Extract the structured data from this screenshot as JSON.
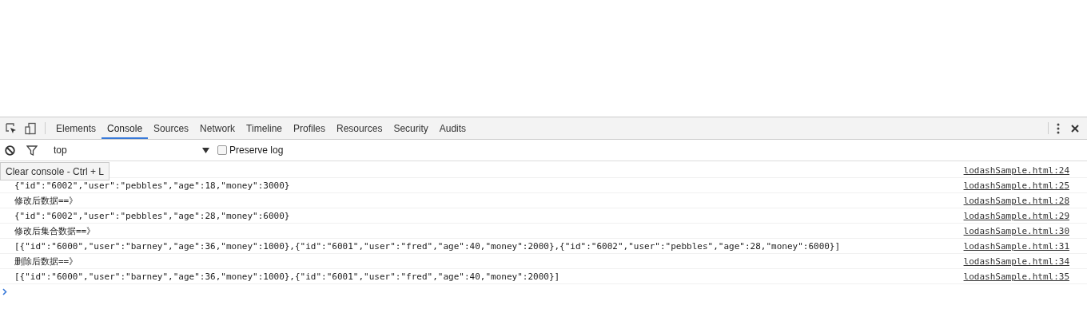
{
  "tabs": [
    {
      "label": "Elements",
      "selected": false
    },
    {
      "label": "Console",
      "selected": true
    },
    {
      "label": "Sources",
      "selected": false
    },
    {
      "label": "Network",
      "selected": false
    },
    {
      "label": "Timeline",
      "selected": false
    },
    {
      "label": "Profiles",
      "selected": false
    },
    {
      "label": "Resources",
      "selected": false
    },
    {
      "label": "Security",
      "selected": false
    },
    {
      "label": "Audits",
      "selected": false
    }
  ],
  "filter": {
    "context": "top",
    "preserve_log": {
      "label": "Preserve log",
      "checked": false
    }
  },
  "tooltip": "Clear console - Ctrl + L",
  "messages": [
    {
      "source": "lodashSample.html:24"
    },
    {
      "text": "{\"id\":\"6002\",\"user\":\"pebbles\",\"age\":18,\"money\":3000}",
      "source": "lodashSample.html:25"
    },
    {
      "text": "修改后数据==》",
      "source": "lodashSample.html:28"
    },
    {
      "text": "{\"id\":\"6002\",\"user\":\"pebbles\",\"age\":28,\"money\":6000}",
      "source": "lodashSample.html:29"
    },
    {
      "text": "修改后集合数据==》",
      "source": "lodashSample.html:30"
    },
    {
      "text": "[{\"id\":\"6000\",\"user\":\"barney\",\"age\":36,\"money\":1000},{\"id\":\"6001\",\"user\":\"fred\",\"age\":40,\"money\":2000},{\"id\":\"6002\",\"user\":\"pebbles\",\"age\":28,\"money\":6000}]",
      "source": "lodashSample.html:31"
    },
    {
      "text": "删除后数据==》",
      "source": "lodashSample.html:34"
    },
    {
      "text": "[{\"id\":\"6000\",\"user\":\"barney\",\"age\":36,\"money\":1000},{\"id\":\"6001\",\"user\":\"fred\",\"age\":40,\"money\":2000}]",
      "source": "lodashSample.html:35"
    }
  ]
}
